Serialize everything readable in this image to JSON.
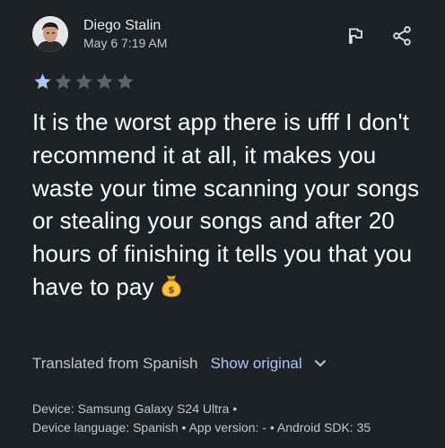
{
  "review": {
    "author": "Diego Stalin",
    "date": "May 6 7:19 AM",
    "rating": 1,
    "max_rating": 5,
    "text": "It is the worst app there is ufff I don't recommend it at all, it makes you waste your time scanning your songs or stealing your songs and after 20 hours of finishing it tells you that you have to pay",
    "emoji": "money-bag"
  },
  "translation": {
    "label": "Translated from Spanish",
    "show_original": "Show original"
  },
  "device": {
    "line1": "Device: Samsung Galaxy S24 Ultra •",
    "line2": "Device language: Spanish • App version: - • Android SDK: 35"
  },
  "icons": [
    "flag-icon",
    "share-icon",
    "chevron-down-icon",
    "star-icon"
  ],
  "colors": {
    "background": "#1e2227",
    "star_filled": "#a8c7fa",
    "star_empty": "#5f6368",
    "link": "#a8c7fa"
  }
}
